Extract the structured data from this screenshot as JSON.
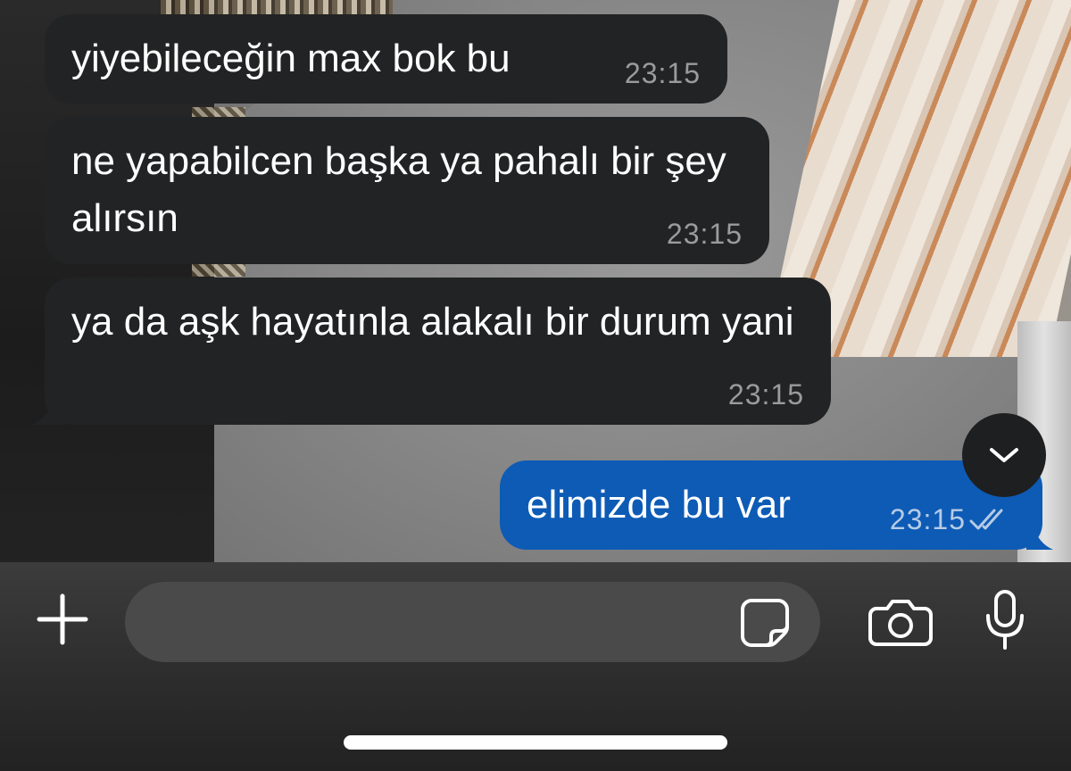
{
  "messages": [
    {
      "direction": "incoming",
      "text": "yiyebileceğin max bok bu",
      "time": "23:15"
    },
    {
      "direction": "incoming",
      "text": "ne yapabilcen başka ya pahalı bir şey alırsın",
      "time": "23:15"
    },
    {
      "direction": "incoming",
      "text": "ya da aşk hayatınla alakalı bir durum yani",
      "time": "23:15"
    },
    {
      "direction": "outgoing",
      "text": "elimizde bu var",
      "time": "23:15",
      "status": "read"
    }
  ],
  "composer": {
    "placeholder": "",
    "value": ""
  },
  "icons": {
    "scroll_down": "chevron-down-icon",
    "attach": "plus-icon",
    "sticker": "sticker-icon",
    "camera": "camera-icon",
    "mic": "microphone-icon",
    "read_receipt": "double-check-icon"
  },
  "colors": {
    "incoming_bubble": "#222324",
    "outgoing_bubble": "#0d5bb5",
    "timestamp": "#9b9b9b"
  }
}
